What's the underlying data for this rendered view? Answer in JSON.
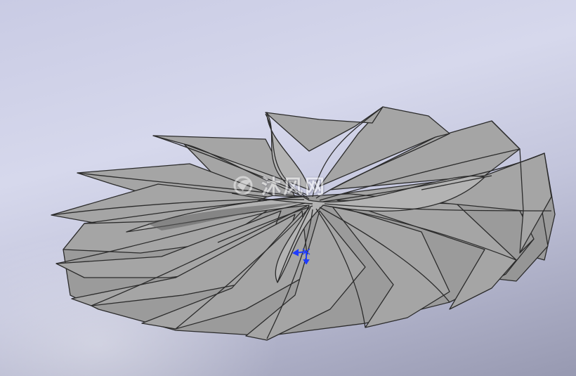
{
  "viewport": {
    "background_top": "#d6d8ec",
    "background_bottom": "#9799b1",
    "model": {
      "part": "impeller",
      "face_color": "#a5a5a5",
      "face_shade_color": "#8e8e8e",
      "edge_color": "#2b2b2b",
      "blade_count": 14
    },
    "watermark": {
      "logo_icon": "watermark-logo-icon",
      "text": "沐风网"
    },
    "reference_triad": {
      "icon": "coordinate-triad-icon",
      "color": "#1f3cff"
    }
  }
}
